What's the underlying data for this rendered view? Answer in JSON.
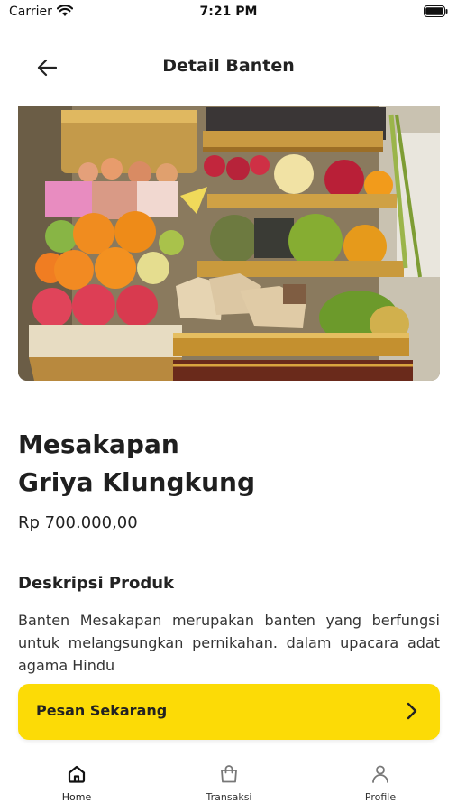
{
  "status_bar": {
    "carrier": "Carrier",
    "time": "7:21 PM"
  },
  "header": {
    "title": "Detail Banten",
    "back_icon": "arrow-left-icon"
  },
  "product": {
    "image_alt": "Banten Mesakapan",
    "title_line1": "Mesakapan",
    "title_line2": "Griya Klungkung",
    "price": "Rp 700.000,00",
    "description_heading": "Deskripsi Produk",
    "description": "Banten Mesakapan merupakan banten yang berfungsi untuk melangsungkan pernikahan. dalam upacara adat agama Hindu"
  },
  "order_button": {
    "label": "Pesan Sekarang",
    "icon": "chevron-right-icon",
    "color": "#fcdb06"
  },
  "bottom_nav": {
    "items": [
      {
        "label": "Home",
        "icon": "home-icon",
        "active": true
      },
      {
        "label": "Transaksi",
        "icon": "shopping-bag-icon",
        "active": false
      },
      {
        "label": "Profile",
        "icon": "user-icon",
        "active": false
      }
    ]
  }
}
